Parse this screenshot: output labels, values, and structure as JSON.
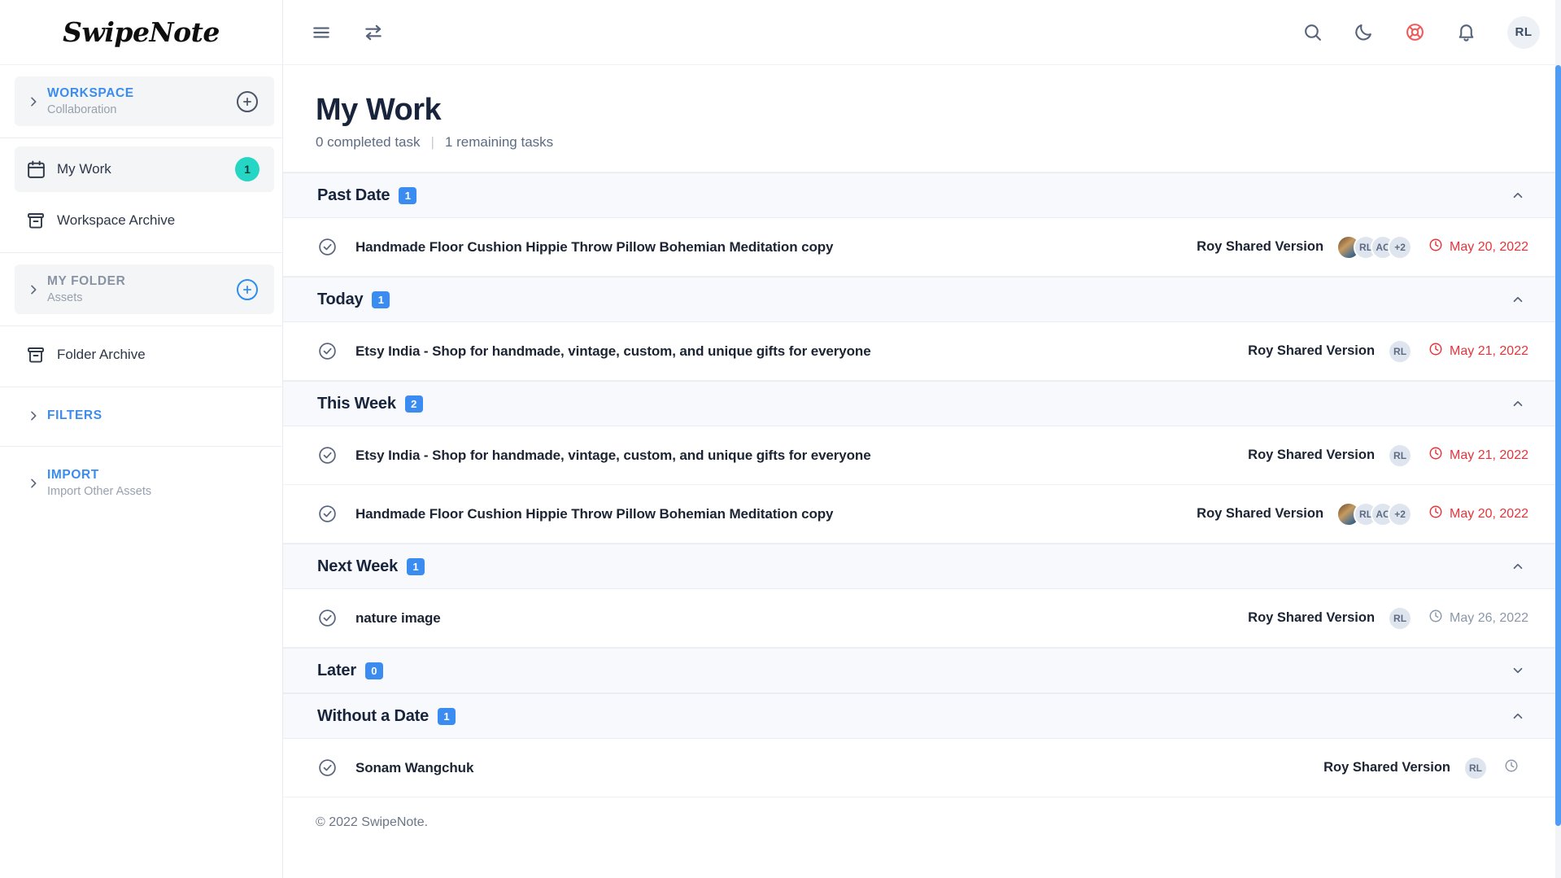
{
  "brand": {
    "logo_text": "SwipeNote"
  },
  "sidebar": {
    "workspace": {
      "title": "WORKSPACE",
      "subtitle": "Collaboration",
      "add_label": "+"
    },
    "my_work": {
      "label": "My Work",
      "badge": "1"
    },
    "workspace_archive": {
      "label": "Workspace Archive"
    },
    "my_folder": {
      "title": "MY FOLDER",
      "subtitle": "Assets",
      "add_label": "+"
    },
    "folder_archive": {
      "label": "Folder Archive"
    },
    "filters": {
      "title": "FILTERS"
    },
    "import": {
      "title": "IMPORT",
      "subtitle": "Import Other Assets"
    }
  },
  "topbar": {
    "menu_icon": "hamburger-icon",
    "swap_icon": "transfer-arrows-icon",
    "search_icon": "search-icon",
    "dark_mode_icon": "moon-icon",
    "help_icon": "lifebuoy-icon",
    "notifications_icon": "bell-icon",
    "avatar_initials": "RL"
  },
  "page": {
    "title": "My Work",
    "completed_text": "0 completed task",
    "separator": "|",
    "remaining_text": "1 remaining tasks"
  },
  "groups": [
    {
      "name": "Past Date",
      "count": "1",
      "expanded": true,
      "tasks": [
        {
          "title": "Handmade Floor Cushion Hippie Throw Pillow Bohemian Meditation copy",
          "owner": "Roy Shared Version",
          "avatars": [
            "photo",
            "RL",
            "AC",
            "+2"
          ],
          "date": "May 20, 2022",
          "overdue": true
        }
      ]
    },
    {
      "name": "Today",
      "count": "1",
      "expanded": true,
      "tasks": [
        {
          "title": "Etsy India - Shop for handmade, vintage, custom, and unique gifts for everyone",
          "owner": "Roy Shared Version",
          "avatars": [
            "RL"
          ],
          "date": "May 21, 2022",
          "overdue": true
        }
      ]
    },
    {
      "name": "This Week",
      "count": "2",
      "expanded": true,
      "tasks": [
        {
          "title": "Etsy India - Shop for handmade, vintage, custom, and unique gifts for everyone",
          "owner": "Roy Shared Version",
          "avatars": [
            "RL"
          ],
          "date": "May 21, 2022",
          "overdue": true
        },
        {
          "title": "Handmade Floor Cushion Hippie Throw Pillow Bohemian Meditation copy",
          "owner": "Roy Shared Version",
          "avatars": [
            "photo",
            "RL",
            "AC",
            "+2"
          ],
          "date": "May 20, 2022",
          "overdue": true
        }
      ]
    },
    {
      "name": "Next Week",
      "count": "1",
      "expanded": true,
      "tasks": [
        {
          "title": "nature image",
          "owner": "Roy Shared Version",
          "avatars": [
            "RL"
          ],
          "date": "May 26, 2022",
          "overdue": false
        }
      ]
    },
    {
      "name": "Later",
      "count": "0",
      "expanded": false,
      "tasks": []
    },
    {
      "name": "Without a Date",
      "count": "1",
      "expanded": true,
      "tasks": [
        {
          "title": "Sonam Wangchuk",
          "owner": "Roy Shared Version",
          "avatars": [
            "RL"
          ],
          "date": "",
          "overdue": false
        }
      ]
    }
  ],
  "footer": {
    "copyright": "© 2022 SwipeNote."
  },
  "colors": {
    "accent_blue": "#3b8cf0",
    "badge_teal": "#25d6c4",
    "overdue_red": "#e8333a",
    "help_red": "#f05a5a",
    "title_dark": "#18243c"
  }
}
